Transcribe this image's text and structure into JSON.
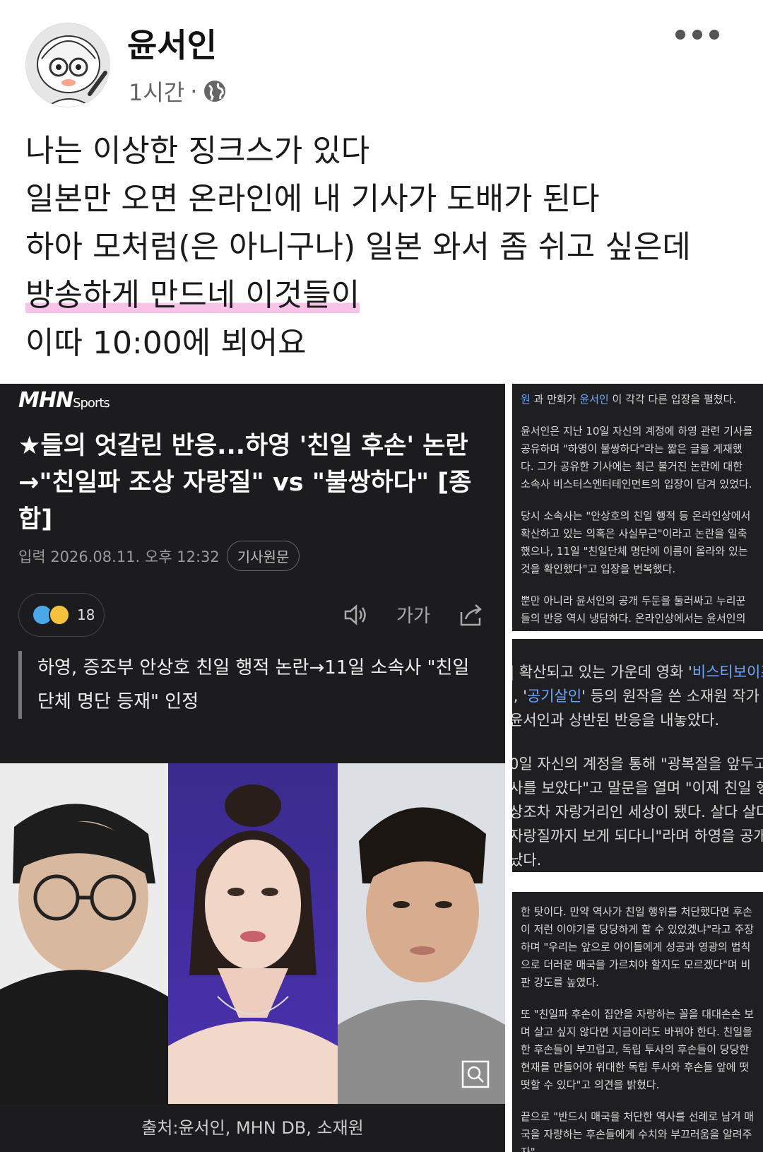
{
  "post": {
    "author": "윤서인",
    "time": "1시간",
    "separator": "·",
    "lines": [
      "나는 이상한 징크스가 있다",
      "일본만 오면 온라인에 내 기사가 도배가 된다",
      "하아 모처럼(은 아니구나) 일본 와서 좀 쉬고 싶은데",
      "방송하게 만드네 이것들이",
      "이따 10:00에 뵈어요"
    ]
  },
  "article": {
    "logo_main": "MHN",
    "logo_sub": "Sports",
    "headline": "★들의 엇갈린 반응...하영 '친일 후손' 논란 →\"친일파 조상 자랑질\" vs \"불쌍하다\" [종합]",
    "date": "입력 2026.08.11. 오후 12:32",
    "original_button": "기사원문",
    "reaction_count": "18",
    "font_size_label": "가가",
    "subhead": "하영, 증조부 안상호 친일 행적 논란→11일 소속사 \"친일단체 명단 등재\" 인정",
    "photo_caption": "출처:윤서인, MHN DB, 소재원"
  },
  "panel1": {
    "p0_a": "원",
    "p0_b": " 과 만화가 ",
    "p0_link": "윤서인",
    "p0_c": " 이 각각 다른 입장을 펼쳤다.",
    "p1": "윤서인은 지난 10일 자신의 계정에 하영 관련 기사를 공유하며 \"하영이 불쌍하다\"라는 짧은 글을 게재했다. 그가 공유한 기사에는 최근 불거진 논란에 대한 소속사 비스터스엔터테인먼트의 입장이 담겨 있었다.",
    "p2": "당시 소속사는 \"안상호의 친일 행적 등 온라인상에서 확산하고 있는 의혹은 사실무근\"이라고 논란을 일축했으나, 11일 \"친일단체 명단에 이름이 올라와 있는 것을 확인했다\"고 입장을 번복했다.",
    "p3": "뿐만 아니라 윤서인의 공개 두둔을 둘러싸고 누리꾼들의 반응 역시 냉담하다. 온라인상에서는 윤서인의 하영"
  },
  "panel2": {
    "l1_a": "| 확산되고 있는 가운데 영화 '",
    "l1_link": "비스티보이즈",
    "l2_a": "', '",
    "l2_link": "공기살인",
    "l2_b": "' 등의 원작을 쓴 소재원 작가",
    "l3": "윤서인과 상반된 반응을 내놓았다.",
    "l4": "0일 자신의 계정을 통해 \"광복절을 앞두고",
    "l5": "사를 보았다\"고 말문을 열며 \"이제 친일 행적",
    "l6": "상조차 자랑거리인 세상이 됐다. 살다 살다 친",
    "l7": "자랑질까지 보게 되다니\"라며 하영을 공개적",
    "l8": "났다."
  },
  "panel3": {
    "p1": "한 탓이다. 만약 역사가 친일 행위를 처단했다면 후손이 저런 이야기를 당당하게 할 수 있었겠냐\"라고 주장하며 \"우리는 앞으로 아이들에게 성공과 영광의 법칙으로 더러운 매국을 가르쳐야 할지도 모르겠다\"며 비판 강도를 높였다.",
    "p2": "또 \"친일파 후손이 집안을 자랑하는 꼴을 대대손손 보며 살고 싶지 않다면 지금이라도 바꿔야 한다. 친일을 한 후손들이 부끄럽고, 독립 투사의 후손들이 당당한 현재를 만들어야 위대한 독립 투사와 후손들 앞에 떳떳할 수 있다\"고 의견을 밝혔다.",
    "p3": "끝으로 \"반드시 매국을 처단한 역사를 선례로 남겨 매국을 자랑하는 후손들에게 수치와 부끄러움을 알려주자\""
  },
  "icons": [
    "globe-icon",
    "more-options-icon",
    "speaker-icon",
    "share-icon",
    "zoom-icon"
  ],
  "colors": {
    "highlight": "#f7c3e8",
    "dark_card": "#1c1c1e",
    "link": "#6ea5ff"
  }
}
